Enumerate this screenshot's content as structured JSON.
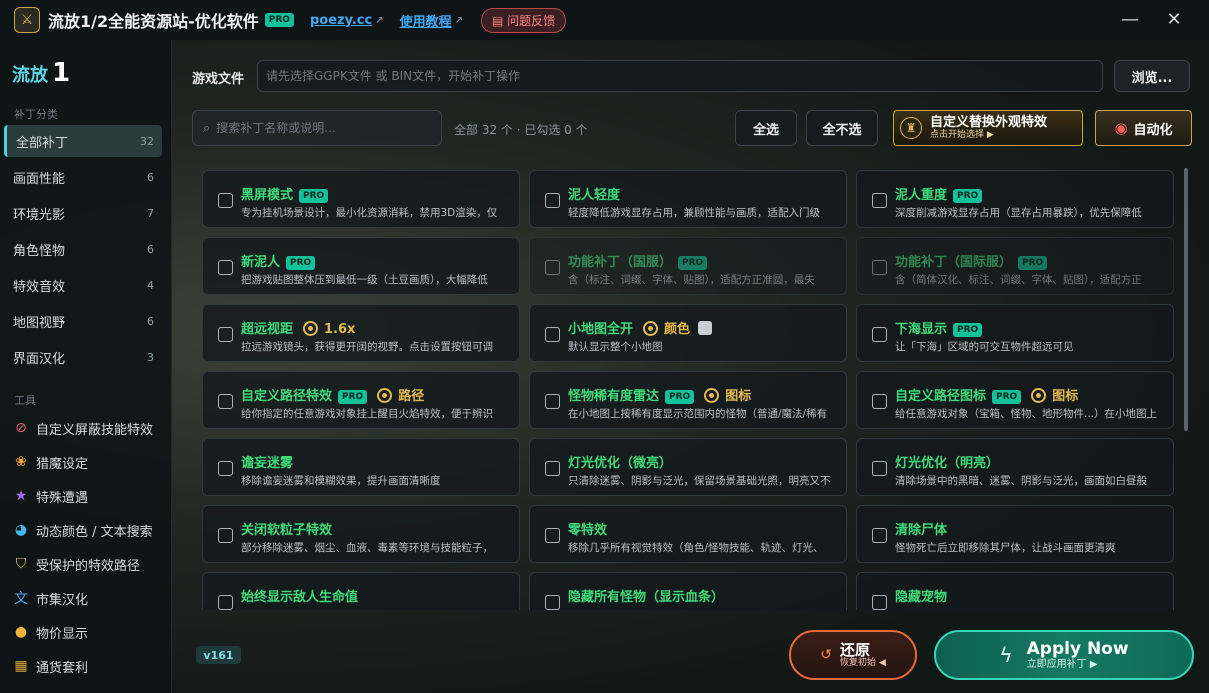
{
  "titlebar": {
    "title": "流放1/2全能资源站-优化软件",
    "pro": "PRO",
    "site": "poezy.cc",
    "tutorial": "使用教程",
    "feedback": "问题反馈",
    "ext_icon": "↗",
    "minimize": "—",
    "close": "✕"
  },
  "brand": {
    "name": "流放",
    "num": "1"
  },
  "sidebar": {
    "patch_section": "补丁分类",
    "items": [
      {
        "label": "全部补丁",
        "count": "32"
      },
      {
        "label": "画面性能",
        "count": "6"
      },
      {
        "label": "环境光影",
        "count": "7"
      },
      {
        "label": "角色怪物",
        "count": "6"
      },
      {
        "label": "特效音效",
        "count": "4"
      },
      {
        "label": "地图视野",
        "count": "6"
      },
      {
        "label": "界面汉化",
        "count": "3"
      }
    ],
    "tools_section": "工具",
    "tools": [
      {
        "icon": "eye-slash-icon",
        "glyph": "⊘",
        "color": "#e8606a",
        "label": "自定义屏蔽技能特效"
      },
      {
        "icon": "paw-icon",
        "glyph": "❀",
        "color": "#f0a23a",
        "label": "猎魔设定"
      },
      {
        "icon": "star-icon",
        "glyph": "★",
        "color": "#a66cf0",
        "label": "特殊遭遇"
      },
      {
        "icon": "palette-icon",
        "glyph": "◕",
        "color": "#3fb6f0",
        "label": "动态颜色 / 文本搜索"
      },
      {
        "icon": "shield-icon",
        "glyph": "⛉",
        "color": "#f0c23a",
        "label": "受保护的特效路径"
      },
      {
        "icon": "translate-icon",
        "glyph": "文",
        "color": "#5aa8f0",
        "label": "市集汉化"
      },
      {
        "icon": "coins-icon",
        "glyph": "●",
        "color": "#f0b43a",
        "label": "物价显示"
      },
      {
        "icon": "money-icon",
        "glyph": "▦",
        "color": "#d8a63a",
        "label": "通货套利"
      }
    ]
  },
  "file": {
    "label": "游戏文件",
    "placeholder": "请先选择GGPK文件 或 BIN文件，开始补丁操作",
    "browse": "浏览..."
  },
  "search": {
    "placeholder": "搜索补丁名称或说明...",
    "info": "全部 32 个 · 已勾选 0 个"
  },
  "buttons": {
    "select_all": "全选",
    "select_none": "全不选",
    "custom_fx_title": "自定义替换外观特效",
    "custom_fx_sub": "点击开始选择 ▶",
    "auto": "自动化"
  },
  "cards": [
    {
      "title": "黑屏模式",
      "pro": true,
      "desc": "专为挂机场景设计，最小化资源消耗，禁用3D渲染，仅",
      "dim": false
    },
    {
      "title": "泥人轻度",
      "pro": false,
      "desc": "轻度降低游戏显存占用，兼顾性能与画质，适配入门级",
      "dim": false
    },
    {
      "title": "泥人重度",
      "pro": true,
      "desc": "深度削减游戏显存占用（显存占用暴跌），优先保障低",
      "dim": false
    },
    {
      "title": "新泥人",
      "pro": true,
      "desc": "把游戏贴图整体压到最低一级（土豆画质），大幅降低",
      "dim": false
    },
    {
      "title": "功能补丁（国服）",
      "pro": true,
      "desc": "含（标注、词缀、字体、贴图），适配方正准圆，最失",
      "dim": true
    },
    {
      "title": "功能补丁（国际服）",
      "pro": true,
      "desc": "含（简体汉化、标注、词缀、字体、贴图），适配方正",
      "dim": true
    },
    {
      "title": "超远视距",
      "pro": false,
      "extra": "1.6x",
      "extra_type": "gear",
      "desc": "拉远游戏镜头，获得更开阔的视野。点击设置按钮可调",
      "dim": false
    },
    {
      "title": "小地图全开",
      "pro": false,
      "extra": "颜色",
      "extra_type": "gear-swatch",
      "desc": "默认显示整个小地图",
      "dim": false
    },
    {
      "title": "下海显示",
      "pro": true,
      "desc": "让「下海」区域的可交互物件超远可见",
      "dim": false
    },
    {
      "title": "自定义路径特效",
      "pro": true,
      "extra": "路径",
      "extra_type": "gear",
      "desc": "给你指定的任意游戏对象挂上醒目火焰特效，便于辨识",
      "dim": false
    },
    {
      "title": "怪物稀有度雷达",
      "pro": true,
      "extra": "图标",
      "extra_type": "gear",
      "desc": "在小地图上按稀有度显示范围内的怪物（普通/魔法/稀有",
      "dim": false
    },
    {
      "title": "自定义路径图标",
      "pro": true,
      "extra": "图标",
      "extra_type": "gear",
      "desc": "给任意游戏对象（宝箱、怪物、地形物件...）在小地图上",
      "dim": false
    },
    {
      "title": "谵妄迷雾",
      "pro": false,
      "desc": "移除谵妄迷雾和模糊效果，提升画面清晰度",
      "dim": false
    },
    {
      "title": "灯光优化（微亮）",
      "pro": false,
      "desc": "只清除迷雾、阴影与泛光，保留场景基础光照，明亮又不",
      "dim": false
    },
    {
      "title": "灯光优化（明亮）",
      "pro": false,
      "desc": "清除场景中的黑暗、迷雾、阴影与泛光，画面如白昼般",
      "dim": false
    },
    {
      "title": "关闭软粒子特效",
      "pro": false,
      "desc": "部分移除迷雾、烟尘、血液、毒素等环境与技能粒子，",
      "dim": false
    },
    {
      "title": "零特效",
      "pro": false,
      "desc": "移除几乎所有视觉特效（角色/怪物技能、轨迹、灯光、",
      "dim": false
    },
    {
      "title": "清除尸体",
      "pro": false,
      "desc": "怪物死亡后立即移除其尸体，让战斗画面更清爽",
      "dim": false
    },
    {
      "title": "始终显示敌人生命值",
      "pro": false,
      "desc": "",
      "dim": false
    },
    {
      "title": "隐藏所有怪物（显示血条）",
      "pro": false,
      "desc": "",
      "dim": false
    },
    {
      "title": "隐藏宠物",
      "pro": false,
      "desc": "",
      "dim": false
    }
  ],
  "footer": {
    "version": "v161",
    "restore_title": "还原",
    "restore_sub": "恢复初始 ◀",
    "apply_title": "Apply Now",
    "apply_sub": "立即应用补丁 ▶"
  },
  "colors": {
    "accent": "#3fd97a",
    "pro_badge": "#13c29a",
    "brand": "#5fd3e6",
    "apply": "#147a62",
    "restore": "#e86a3a",
    "gold": "#e3b84d"
  }
}
